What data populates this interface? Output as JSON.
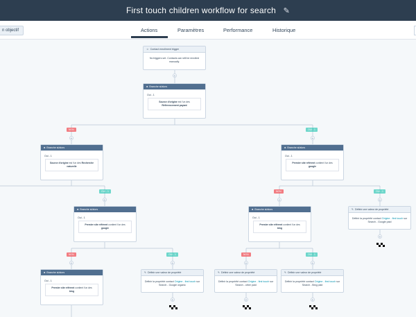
{
  "header": {
    "title": "First touch children workflow for search",
    "edit_icon": "pencil-icon"
  },
  "objective_button": "n objectif",
  "tabs": [
    {
      "label": "Actions",
      "active": true
    },
    {
      "label": "Paramètres",
      "active": false
    },
    {
      "label": "Performance",
      "active": false
    },
    {
      "label": "Historique",
      "active": false
    }
  ],
  "trigger": {
    "title": "Contact enrollment trigger",
    "text": "No triggers set. Contacts can still be enrolled manually."
  },
  "branch_label": "Branche si/alors",
  "oui1": "Oui - 1",
  "non_label": "NON",
  "oui_label": "OUI - 1",
  "set_label": "Définir une valeur de propriété",
  "nodes": {
    "b1": {
      "prop": "Source d'origine",
      "rest": " est l'un des",
      "value": "Référencement payant"
    },
    "b2": {
      "prop": "Source d'origine",
      "rest": " est l'un des",
      "value": "Recherche naturelle"
    },
    "b3": {
      "prop": "Premier site référent",
      "rest": " contient l'un des",
      "value": "google"
    },
    "b4": {
      "prop": "Premier site référent",
      "rest": " contient l'un des",
      "value": "google"
    },
    "b5": {
      "prop": "Premier site référent",
      "rest": " contient l'un des",
      "value": "bing"
    },
    "b6": {
      "prop": "Premier site référent",
      "rest": " contient l'un des",
      "value": "bing"
    }
  },
  "sets": {
    "s1": {
      "pre": "Définir la propriété contact ",
      "link": "Origine - first touch",
      "post": " sur Search - Google paid"
    },
    "s2": {
      "pre": "Définir la propriété contact ",
      "link": "Origine - first touch",
      "post": " sur Search - Google organic"
    },
    "s3": {
      "pre": "Définir la propriété contact ",
      "link": "Origine - first touch",
      "post": " sur Search - other paid"
    },
    "s4": {
      "pre": "Définir la propriété contact ",
      "link": "Origine - first touch",
      "post": " sur Search - Bing paid"
    }
  },
  "plus_glyph": "+",
  "colors": {
    "topbar": "#2d3e50",
    "branch_header": "#516f90",
    "non": "#f2545b",
    "oui": "#00bda5",
    "link": "#0091ae"
  }
}
